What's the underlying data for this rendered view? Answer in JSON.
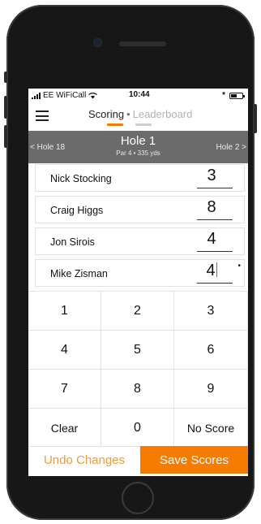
{
  "status_bar": {
    "carrier": "EE WiFiCall",
    "time": "10:44",
    "bluetooth": "*",
    "battery_level": 0.5
  },
  "nav": {
    "tab_scoring": "Scoring",
    "separator": "•",
    "tab_leaderboard": "Leaderboard",
    "accent_color": "#f57c00"
  },
  "hole": {
    "prev": "< Hole 18",
    "title": "Hole 1",
    "subtitle": "Par 4 • 335 yds",
    "next": "Hole 2 >"
  },
  "players": [
    {
      "name": "Nick Stocking",
      "score": "3"
    },
    {
      "name": "Craig Higgs",
      "score": "8"
    },
    {
      "name": "Jon Sirois",
      "score": "4"
    },
    {
      "name": "Mike Zisman",
      "score": "4",
      "marker": "•"
    }
  ],
  "keypad": {
    "keys": [
      "1",
      "2",
      "3",
      "4",
      "5",
      "6",
      "7",
      "8",
      "9",
      "Clear",
      "0",
      "No Score"
    ]
  },
  "actions": {
    "undo": "Undo Changes",
    "save": "Save Scores"
  }
}
